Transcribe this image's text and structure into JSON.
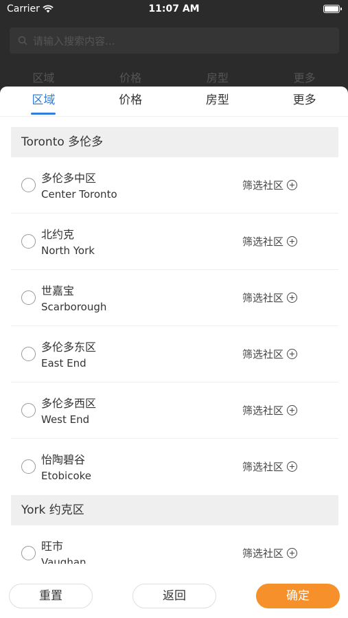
{
  "status_bar": {
    "carrier": "Carrier",
    "time": "11:07 AM"
  },
  "background": {
    "search_placeholder": "请输入搜索内容...",
    "filters": [
      "区域",
      "价格",
      "房型",
      "更多"
    ]
  },
  "tabs": [
    {
      "label": "区域",
      "active": true
    },
    {
      "label": "价格",
      "active": false
    },
    {
      "label": "房型",
      "active": false
    },
    {
      "label": "更多",
      "active": false
    }
  ],
  "sections": [
    {
      "title": "Toronto 多伦多",
      "items": [
        {
          "zh": "多伦多中区",
          "en": "Center Toronto",
          "action": "筛选社区"
        },
        {
          "zh": "北约克",
          "en": "North York",
          "action": "筛选社区"
        },
        {
          "zh": "世嘉宝",
          "en": "Scarborough",
          "action": "筛选社区"
        },
        {
          "zh": "多伦多东区",
          "en": "East End",
          "action": "筛选社区"
        },
        {
          "zh": "多伦多西区",
          "en": "West End",
          "action": "筛选社区"
        },
        {
          "zh": "怡陶碧谷",
          "en": "Etobicoke",
          "action": "筛选社区"
        }
      ]
    },
    {
      "title": "York 约克区",
      "items": [
        {
          "zh": "旺市",
          "en": "Vaughan",
          "action": "筛选社区"
        }
      ]
    }
  ],
  "footer": {
    "reset_label": "重置",
    "back_label": "返回",
    "confirm_label": "确定"
  },
  "colors": {
    "accent": "#2f7ddf",
    "confirm": "#f6902b"
  }
}
